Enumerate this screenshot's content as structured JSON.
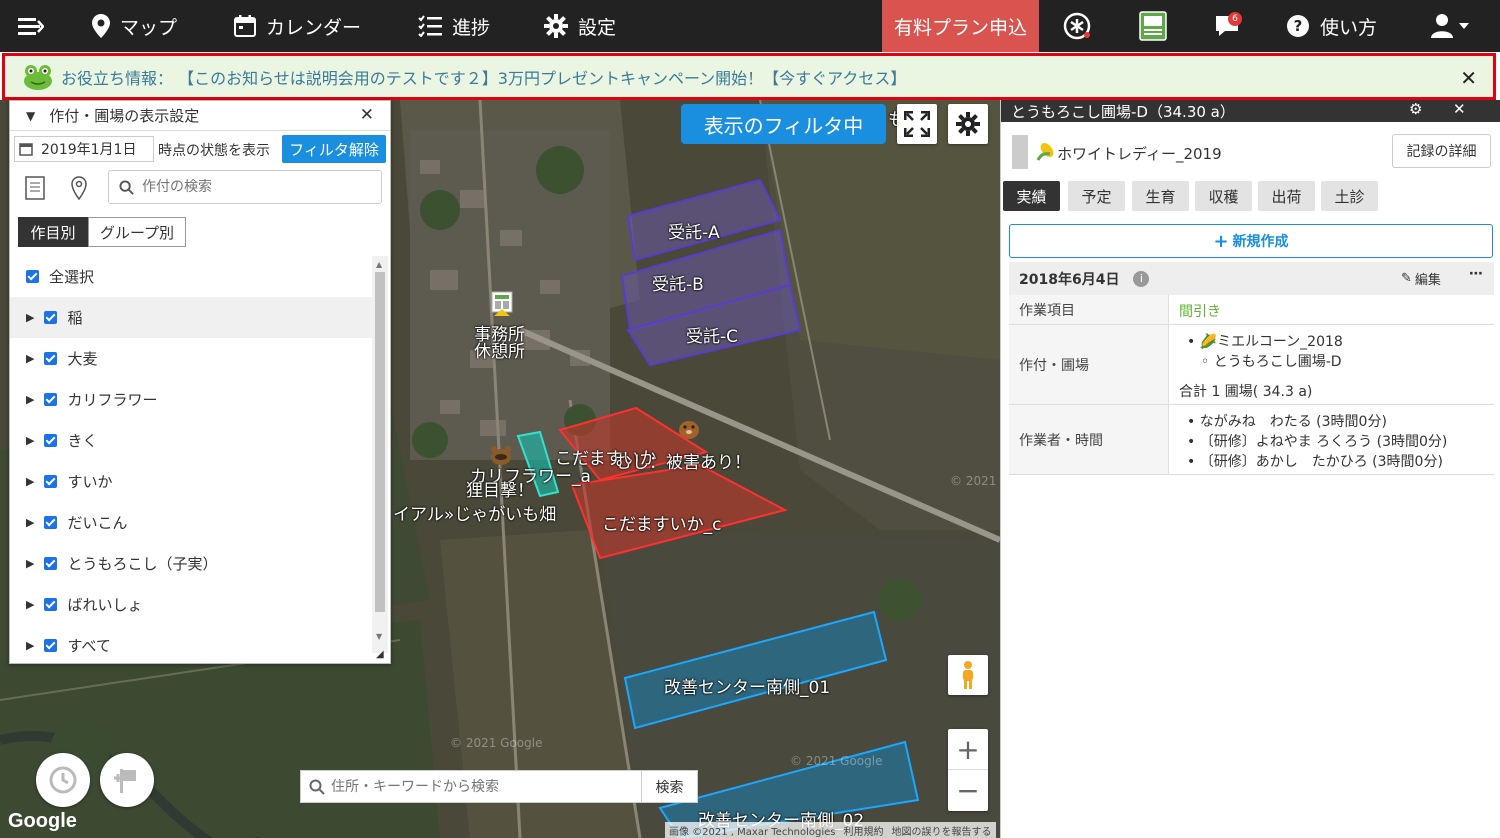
{
  "nav": {
    "map": "マップ",
    "calendar": "カレンダー",
    "progress": "進捗",
    "settings": "設定",
    "plan": "有料プラン申込",
    "notif_count": "6",
    "help": "使い方"
  },
  "notice": {
    "text": "お役立ち情報： 【このお知らせは説明会用のテストです２】3万円プレゼントキャンペーン開始！【今すぐアクセス】"
  },
  "panel": {
    "title": "作付・圃場の表示設定",
    "date": "2019年1月1日",
    "date_suffix": "時点の状態を表示",
    "filter_clear": "フィルタ解除",
    "search_placeholder": "作付の検索",
    "tab_crop": "作目別",
    "tab_group": "グループ別",
    "select_all": "全選択",
    "crops": [
      "稲",
      "大麦",
      "カリフラワー",
      "きく",
      "すいか",
      "だいこん",
      "とうもろこし（子実）",
      "ばれいしょ",
      "すべて"
    ]
  },
  "map": {
    "filter_badge": "表示のフィルタ中",
    "office": "事務所",
    "rest": "休憩所",
    "fields": {
      "a": "受託-A",
      "b": "受託-B",
      "c": "受託-C",
      "kodama_a": "こだますいか",
      "damage": "むし：被害あり！",
      "cauli_a": "カリフラワー_a",
      "tanuki": "狸目撃！",
      "potato": "イアル»じゃがいも畑",
      "kodama_c": "こだますいか_c",
      "south01": "改善センター南側_01",
      "south02": "改善センター南側_02",
      "truncated": "も"
    },
    "search_placeholder": "住所・キーワードから検索",
    "search_button": "検索",
    "google": "Google",
    "attribution": "画像 ©2021 , Maxar Technologies",
    "terms": "利用規約",
    "report": "地図の誤りを報告する",
    "watermark1": "© 2021 Google",
    "watermark2": "© 2021 Google",
    "watermark3": "© 2021"
  },
  "detail": {
    "header": "とうもろこし圃場-D（34.30 a）",
    "crop_name": "ホワイトレディー_2019",
    "record_detail": "記録の詳細",
    "tabs": [
      "実績",
      "予定",
      "生育",
      "収穫",
      "出荷",
      "土診"
    ],
    "new_button": "新規作成",
    "date": "2018年6月4日",
    "edit": "編集",
    "rows": {
      "work_label": "作業項目",
      "work_value": "間引き",
      "field_label": "作付・圃場",
      "field_crop": "ミエルコーン_2018",
      "field_name": "とうもろこし圃場-D",
      "field_total": "合計 1 圃場( 34.3 a)",
      "worker_label": "作業者・時間",
      "workers": [
        "ながみね　わたる (3時間0分)",
        "〔研修〕よねやま ろくろう (3時間0分)",
        "〔研修〕あかし　たかひろ (3時間0分)"
      ]
    }
  },
  "colors": {
    "nav_bg": "#222222",
    "plan_bg": "#d9534f",
    "accent_blue": "#1a8fe0",
    "notice_border": "#e3000f",
    "work_green": "#5fb233"
  }
}
